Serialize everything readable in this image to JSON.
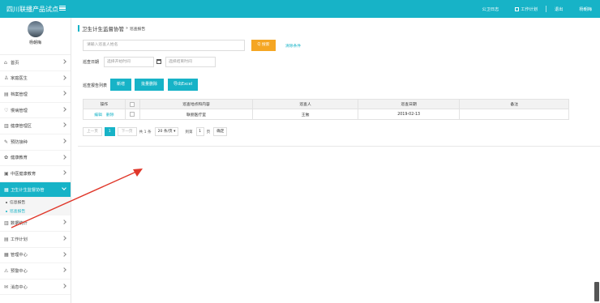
{
  "header": {
    "app_title": "四川联播产品试点",
    "links": {
      "notice": "公卫日志",
      "work_plan": "工作计划",
      "logout": "退出",
      "user": "杨朝梅"
    }
  },
  "sidebar": {
    "username": "杨朝梅",
    "items": [
      {
        "label": "首页",
        "icon": "⌂"
      },
      {
        "label": "家庭医生",
        "icon": "♙"
      },
      {
        "label": "档案管理",
        "icon": "▤"
      },
      {
        "label": "慢病管理",
        "icon": "♡"
      },
      {
        "label": "健康管理区",
        "icon": "▥"
      },
      {
        "label": "预防接种",
        "icon": "✎"
      },
      {
        "label": "健康教育",
        "icon": "✿"
      },
      {
        "label": "中医健康教育",
        "icon": "▣"
      },
      {
        "label": "卫生计生监督协管",
        "icon": "▦"
      },
      {
        "label": "数据统计",
        "icon": "▥"
      },
      {
        "label": "工作计划",
        "icon": "▤"
      },
      {
        "label": "管理中心",
        "icon": "▦"
      },
      {
        "label": "预警中心",
        "icon": "⚠"
      },
      {
        "label": "消息中心",
        "icon": "✉"
      }
    ],
    "submenu": [
      {
        "label": "信息报告"
      },
      {
        "label": "巡查报告"
      }
    ]
  },
  "breadcrumb": {
    "current": "卫生计生监督协管",
    "separator": "»",
    "sub": "巡查报告"
  },
  "search": {
    "placeholder": "请输入巡查人姓名",
    "button": "Q 搜索",
    "clear": "清除条件"
  },
  "date_filter": {
    "label": "巡查日期",
    "start_placeholder": "选择开始时间",
    "end_placeholder": "选择结束时间"
  },
  "list_section": {
    "label": "巡查报告列表",
    "buttons": {
      "add": "新增",
      "batch_delete": "批量删除",
      "export": "导出Excel"
    }
  },
  "table": {
    "headers": {
      "op": "操作",
      "content": "巡查地点和内容",
      "person": "巡查人",
      "date": "巡查日期",
      "remark": "备注"
    },
    "rows": [
      {
        "edit": "编辑",
        "delete": "删除",
        "content": "联丽医疗室",
        "person": "王勉",
        "date": "2019-02-13",
        "remark": ""
      }
    ]
  },
  "pagination": {
    "prev": "上一页",
    "page": "1",
    "next": "下一页",
    "total": "共 1 条",
    "page_size": "20 条/页 ▾",
    "goto_label": "到第",
    "goto_value": "1",
    "page_unit": "页",
    "confirm": "确定"
  },
  "colors": {
    "accent": "#17b3c7",
    "search_button": "#f5a623",
    "annotation_arrow": "#e0372a"
  }
}
